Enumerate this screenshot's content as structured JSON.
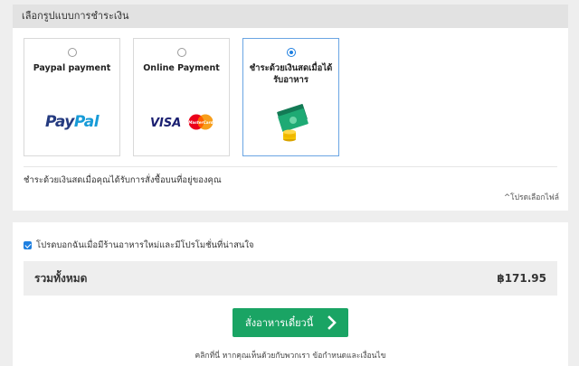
{
  "payment": {
    "header": "เลือกรูปแบบการชำระเงิน",
    "options": [
      {
        "label": "Paypal payment",
        "selected": false,
        "logo_text_1": "Pay",
        "logo_text_2": "Pal"
      },
      {
        "label": "Online Payment",
        "selected": false,
        "logo_text": "VISA",
        "mc_text": "MasterCard"
      },
      {
        "label": "ชำระด้วยเงินสดเมื่อได้รับอาหาร",
        "selected": true,
        "icon": "cash-coins-icon"
      }
    ],
    "description": "ชำระด้วยเงินสดเมื่อคุณได้รับการสั่งซื้อบนที่อยู่ของคุณ",
    "change_link": "^โปรดเลือกไฟล์"
  },
  "order": {
    "newsletter_label": "โปรดบอกฉันเมื่อมีร้านอาหารใหม่และมีโปรโมชั่นที่น่าสนใจ",
    "newsletter_checked": true,
    "total_label": "รวมทั้งหมด",
    "total_amount": "฿171.95",
    "submit_label": "สั่งอาหารเดี๋ยวนี้",
    "terms_text": "คลิกที่นี่ หากคุณเห็นด้วยกับพวกเรา ข้อกำหนดและเงื่อนไข"
  },
  "colors": {
    "accent_blue": "#1e7fe0",
    "button_green": "#1aa464",
    "paypal_dark": "#253b80",
    "paypal_light": "#179bd7"
  }
}
